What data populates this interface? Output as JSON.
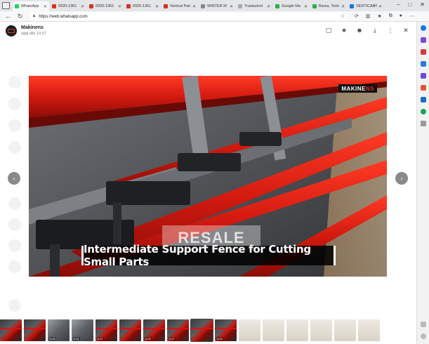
{
  "browser": {
    "tabs": [
      {
        "title": "WhatsApp",
        "fav": "#25d366",
        "active": true
      },
      {
        "title": "0920-1361",
        "fav": "#d93025"
      },
      {
        "title": "0920-1361",
        "fav": "#d93025"
      },
      {
        "title": "0920-1361",
        "fav": "#d93025"
      },
      {
        "title": "Vertical Pan",
        "fav": "#d93025"
      },
      {
        "title": "WINTER M",
        "fav": "#888888"
      },
      {
        "title": "Traslazioni",
        "fav": "#aaaaaa"
      },
      {
        "title": "Google Ma",
        "fav": "#34a853"
      },
      {
        "title": "Barsa, Torin",
        "fav": "#34a853"
      },
      {
        "title": "VERTICAL S",
        "fav": "#1a73e8"
      }
    ],
    "url": "https://web.whatsapp.com"
  },
  "viewer": {
    "sender_name": "Makinens",
    "sender_time": "oggi alle 10:37",
    "caption": "Intermediate Support Fence for Cutting Small Parts",
    "photo_logo_white": "MAKINE",
    "photo_logo_red": "NS",
    "watermark": "RESALE",
    "thumbnails": [
      {
        "kind": "red",
        "dur": ""
      },
      {
        "kind": "red",
        "dur": ""
      },
      {
        "kind": "grey",
        "dur": "0:03"
      },
      {
        "kind": "grey",
        "dur": "0:21"
      },
      {
        "kind": "red",
        "dur": "0:47"
      },
      {
        "kind": "red",
        "dur": ""
      },
      {
        "kind": "red",
        "dur": "0:09"
      },
      {
        "kind": "red",
        "dur": "0:47"
      },
      {
        "kind": "red",
        "dur": "",
        "sel": true
      },
      {
        "kind": "red",
        "dur": "0:04"
      },
      {
        "kind": "paper",
        "dur": ""
      },
      {
        "kind": "paper",
        "dur": ""
      },
      {
        "kind": "paper",
        "dur": ""
      },
      {
        "kind": "paper",
        "dur": ""
      },
      {
        "kind": "paper",
        "dur": ""
      },
      {
        "kind": "paper",
        "dur": ""
      }
    ]
  }
}
